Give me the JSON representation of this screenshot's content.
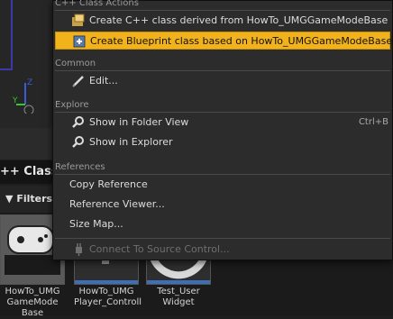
{
  "header": {
    "title": "++ Classes"
  },
  "filters": {
    "label": "Filters"
  },
  "assets": [
    {
      "label": "HowTo_UMG GameMode Base"
    },
    {
      "label": "HowTo_UMG Player_Controll"
    },
    {
      "label": "Test_User Widget"
    }
  ],
  "menu": {
    "sections": {
      "cpp": "C++ Class Actions",
      "common": "Common",
      "explore": "Explore",
      "references": "References"
    },
    "items": {
      "create_cpp": "Create C++ class derived from HowTo_UMGGameModeBase",
      "create_bp": "Create Blueprint class based on HowTo_UMGGameModeBase",
      "edit": "Edit...",
      "show_folder": "Show in Folder View",
      "show_folder_shortcut": "Ctrl+B",
      "show_explorer": "Show in Explorer",
      "copy_ref": "Copy Reference",
      "ref_viewer": "Reference Viewer...",
      "size_map": "Size Map...",
      "source_control": "Connect To Source Control..."
    }
  },
  "colors": {
    "highlight": "#f2b21b",
    "menu_bg": "#2c2c2c"
  }
}
